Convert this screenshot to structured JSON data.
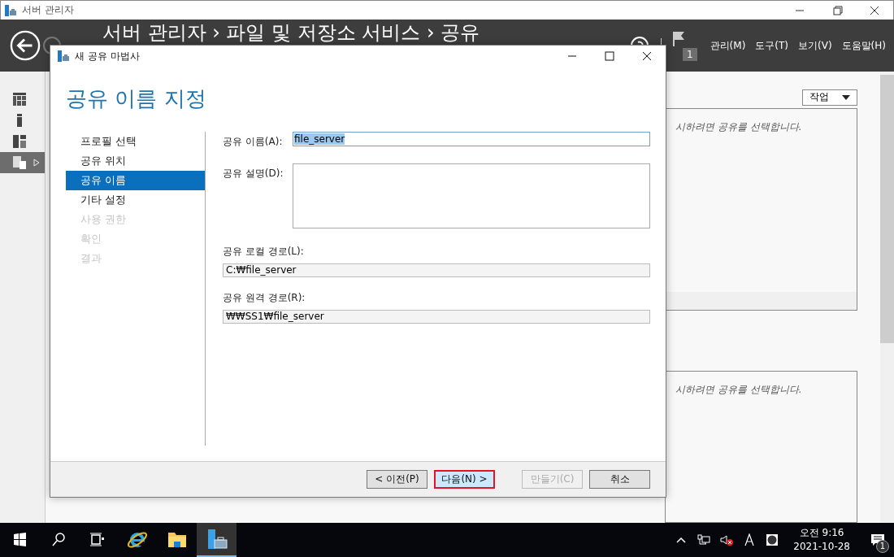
{
  "window": {
    "title": "서버 관리자"
  },
  "header": {
    "breadcrumb": "서버 관리자 › 파일 및 저장소 서비스 › 공유",
    "notification_count": "1",
    "menu": [
      "관리(M)",
      "도구(T)",
      "보기(V)",
      "도움말(H)"
    ]
  },
  "nav": [
    {
      "kind": "dashboard",
      "selected": false
    },
    {
      "kind": "server",
      "selected": false
    },
    {
      "kind": "servers",
      "selected": false
    },
    {
      "kind": "files",
      "selected": true
    }
  ],
  "background": {
    "tasks_button": "작업",
    "hints": [
      "시하려면 공유를 선택합니다.",
      "시하려면 공유를 선택합니다."
    ]
  },
  "dialog": {
    "title": "새 공유 마법사",
    "heading": "공유 이름 지정",
    "steps": [
      {
        "label": "프로필 선택",
        "selected": false,
        "disabled": false
      },
      {
        "label": "공유 위치",
        "selected": false,
        "disabled": false
      },
      {
        "label": "공유 이름",
        "selected": true,
        "disabled": false
      },
      {
        "label": "기타 설정",
        "selected": false,
        "disabled": false
      },
      {
        "label": "사용 권한",
        "selected": false,
        "disabled": true
      },
      {
        "label": "확인",
        "selected": false,
        "disabled": true
      },
      {
        "label": "결과",
        "selected": false,
        "disabled": true
      }
    ],
    "fields": [
      {
        "kind": "text",
        "label": "공유 이름(A):",
        "value": "file_server",
        "text_selected": true
      },
      {
        "kind": "textarea",
        "label": "공유 설명(D):"
      },
      {
        "kind": "readonly",
        "label": "공유 로컬 경로(L):",
        "value": "C:₩file_server"
      },
      {
        "kind": "readonly",
        "label": "공유 원격 경로(R):",
        "value": "₩₩SS1₩file_server"
      }
    ],
    "buttons": [
      {
        "label": "< 이전(P)",
        "disabled": false,
        "focused": false
      },
      {
        "label": "다음(N) >",
        "disabled": false,
        "focused": true
      },
      {
        "label": "만들기(C)",
        "disabled": true,
        "focused": false
      },
      {
        "label": "취소",
        "disabled": false,
        "focused": false
      }
    ]
  },
  "taskbar": {
    "apps": [
      {
        "kind": "ie",
        "active": false
      },
      {
        "kind": "explorer",
        "active": false
      },
      {
        "kind": "server-manager",
        "active": true
      }
    ],
    "time": "오전 9:16",
    "date": "2021-10-28",
    "notification_count": "1"
  }
}
